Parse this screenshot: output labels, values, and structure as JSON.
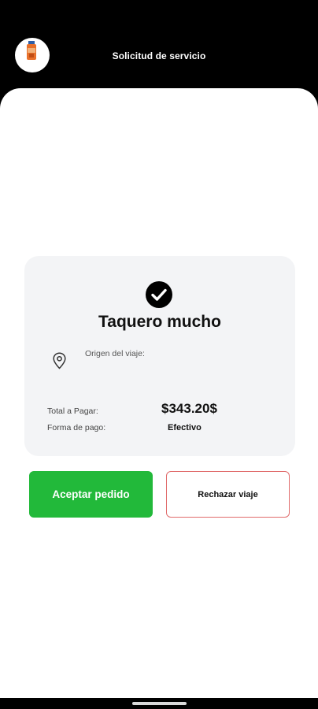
{
  "header": {
    "title": "Solicitud de servicio",
    "avatar_icon": "product-bottle-icon"
  },
  "card": {
    "status_icon": "check-circle-icon",
    "title": "Taquero mucho",
    "origin_icon": "location-pin-icon",
    "origin_label": "Origen del viaje:",
    "origin_value": "",
    "total_label": "Total a Pagar:",
    "total_value": "$343.20$",
    "payment_label": "Forma de pago:",
    "payment_value": "Efectivo"
  },
  "actions": {
    "accept_label": "Aceptar pedido",
    "reject_label": "Rechazar viaje"
  },
  "colors": {
    "accept": "#22b93a",
    "reject_border": "#e06b6b",
    "card_bg": "#f3f4f6"
  }
}
